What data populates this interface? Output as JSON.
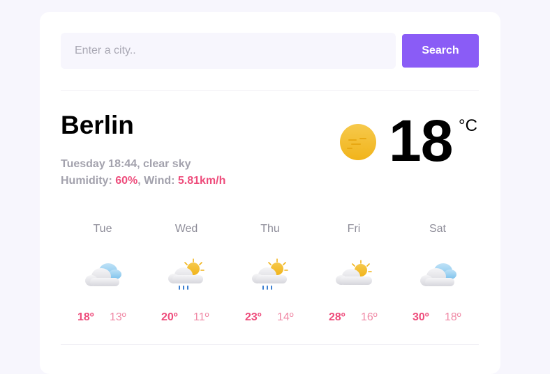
{
  "search": {
    "placeholder": "Enter a city..",
    "value": "",
    "button_label": "Search"
  },
  "current": {
    "city": "Berlin",
    "datetime_desc": "Tuesday 18:44, clear sky",
    "humidity_label": "Humidity:",
    "humidity_value": "60%",
    "wind_label": ", Wind:",
    "wind_value": "5.81km/h",
    "temperature": "18",
    "unit": "°C",
    "icon": "sun-icon"
  },
  "forecast": [
    {
      "day": "Tue",
      "icon": "cloudy-icon",
      "high": "18º",
      "low": "13º"
    },
    {
      "day": "Wed",
      "icon": "rain-icon",
      "high": "20º",
      "low": "11º"
    },
    {
      "day": "Thu",
      "icon": "rain-icon",
      "high": "23º",
      "low": "14º"
    },
    {
      "day": "Fri",
      "icon": "partly-cloudy-icon",
      "high": "28º",
      "low": "16º"
    },
    {
      "day": "Sat",
      "icon": "cloudy-icon",
      "high": "30º",
      "low": "18º"
    }
  ],
  "colors": {
    "accent": "#8a5cf6",
    "temp_accent": "#ee4d7c",
    "background": "#f7f6fd"
  }
}
